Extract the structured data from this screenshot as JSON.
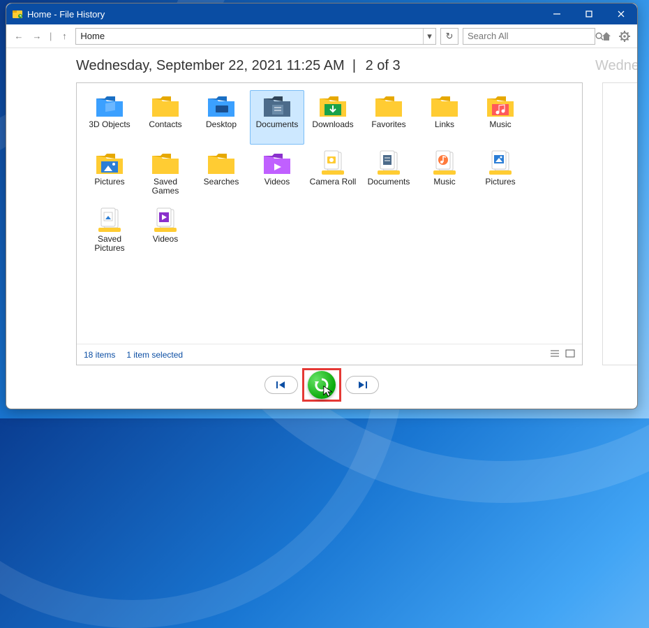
{
  "titlebar": {
    "title": "Home - File History"
  },
  "toolbar": {
    "address": "Home",
    "search_placeholder": "Search All"
  },
  "heading": {
    "date_text": "Wednesday, September 22, 2021 11:25 AM",
    "page_info": "2 of 3",
    "ghost": "Wedne"
  },
  "status": {
    "item_count": "18 items",
    "selection": "1 item selected"
  },
  "items": [
    {
      "label": "3D Objects",
      "icon": "folder-3d",
      "selected": false
    },
    {
      "label": "Contacts",
      "icon": "folder",
      "selected": false
    },
    {
      "label": "Desktop",
      "icon": "folder-desktop",
      "selected": false
    },
    {
      "label": "Documents",
      "icon": "folder-doc",
      "selected": true
    },
    {
      "label": "Downloads",
      "icon": "folder-download",
      "selected": false
    },
    {
      "label": "Favorites",
      "icon": "folder",
      "selected": false
    },
    {
      "label": "Links",
      "icon": "folder",
      "selected": false
    },
    {
      "label": "Music",
      "icon": "folder-music",
      "selected": false
    },
    {
      "label": "Pictures",
      "icon": "folder-pictures",
      "selected": false
    },
    {
      "label": "Saved Games",
      "icon": "folder",
      "selected": false
    },
    {
      "label": "Searches",
      "icon": "folder",
      "selected": false
    },
    {
      "label": "Videos",
      "icon": "folder-videos",
      "selected": false
    },
    {
      "label": "Camera Roll",
      "icon": "lib-camera",
      "selected": false
    },
    {
      "label": "Documents",
      "icon": "lib-doc",
      "selected": false
    },
    {
      "label": "Music",
      "icon": "lib-music",
      "selected": false
    },
    {
      "label": "Pictures",
      "icon": "lib-pictures",
      "selected": false
    },
    {
      "label": "Saved Pictures",
      "icon": "lib-saved",
      "selected": false
    },
    {
      "label": "Videos",
      "icon": "lib-videos",
      "selected": false
    }
  ]
}
